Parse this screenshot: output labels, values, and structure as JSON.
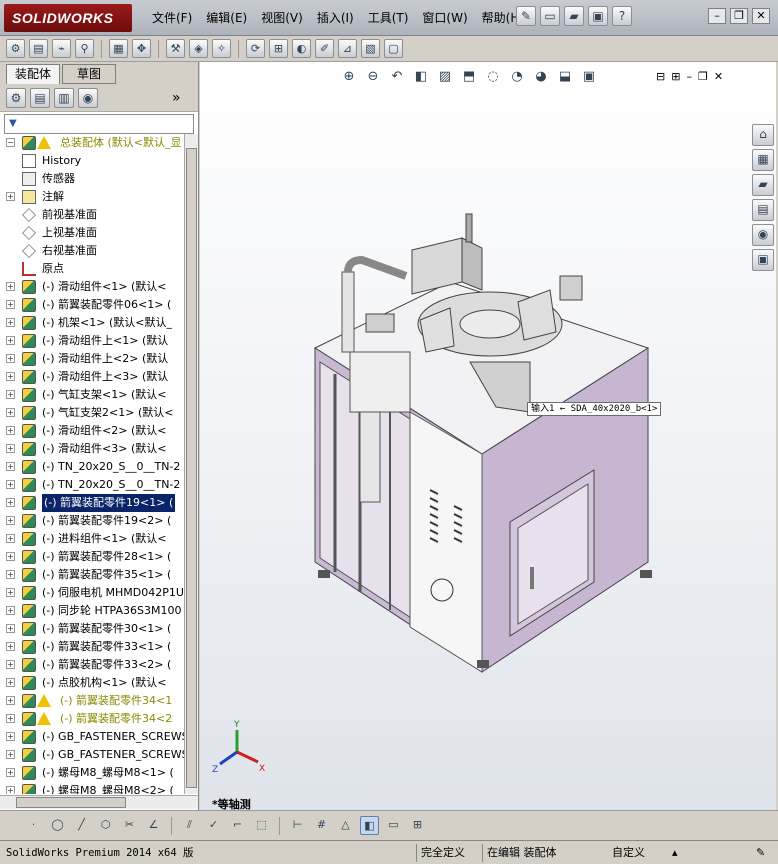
{
  "app": {
    "logo": "SOLIDWORKS"
  },
  "menu": [
    "文件(F)",
    "编辑(E)",
    "视图(V)",
    "插入(I)",
    "工具(T)",
    "窗口(W)",
    "帮助(H)"
  ],
  "panel": {
    "tabs": [
      "装配体",
      "草图"
    ],
    "filter_icon": "filter-icon"
  },
  "tree": [
    {
      "label": "总装配体 (默认<默认_显",
      "type": "root"
    },
    {
      "label": "History",
      "type": "history"
    },
    {
      "label": "传感器",
      "type": "sensor"
    },
    {
      "label": "注解",
      "type": "annotation",
      "exp": true
    },
    {
      "label": "前视基准面",
      "type": "plane"
    },
    {
      "label": "上视基准面",
      "type": "plane"
    },
    {
      "label": "右视基准面",
      "type": "plane"
    },
    {
      "label": "原点",
      "type": "origin"
    },
    {
      "label": "(-) 滑动组件<1> (默认<",
      "type": "part"
    },
    {
      "label": "(-) 箭翼装配零件06<1> (",
      "type": "part"
    },
    {
      "label": "(-) 机架<1> (默认<默认_",
      "type": "part"
    },
    {
      "label": "(-) 滑动组件上<1> (默认",
      "type": "part"
    },
    {
      "label": "(-) 滑动组件上<2> (默认",
      "type": "part"
    },
    {
      "label": "(-) 滑动组件上<3> (默认",
      "type": "part"
    },
    {
      "label": "(-) 气缸支架<1> (默认<",
      "type": "part"
    },
    {
      "label": "(-) 气缸支架2<1> (默认<",
      "type": "part"
    },
    {
      "label": "(-) 滑动组件<2> (默认<",
      "type": "part"
    },
    {
      "label": "(-) 滑动组件<3> (默认<",
      "type": "part"
    },
    {
      "label": "(-) TN_20x20_S__0__TN-2",
      "type": "part"
    },
    {
      "label": "(-) TN_20x20_S__0__TN-2",
      "type": "part"
    },
    {
      "label": "(-) 箭翼装配零件19<1> (",
      "type": "part",
      "selected": true
    },
    {
      "label": "(-) 箭翼装配零件19<2> (",
      "type": "part"
    },
    {
      "label": "(-) 进料组件<1> (默认<",
      "type": "part"
    },
    {
      "label": "(-) 箭翼装配零件28<1> (",
      "type": "part"
    },
    {
      "label": "(-) 箭翼装配零件35<1> (",
      "type": "part"
    },
    {
      "label": "(-) 伺服电机 MHMD042P1U",
      "type": "part"
    },
    {
      "label": "(-) 同步轮 HTPA36S3M100",
      "type": "part"
    },
    {
      "label": "(-) 箭翼装配零件30<1> (",
      "type": "part"
    },
    {
      "label": "(-) 箭翼装配零件33<1> (",
      "type": "part"
    },
    {
      "label": "(-) 箭翼装配零件33<2> (",
      "type": "part"
    },
    {
      "label": "(-) 点胶机构<1> (默认<",
      "type": "part"
    },
    {
      "label": "(-) 箭翼装配零件34<1",
      "type": "warn"
    },
    {
      "label": "(-) 箭翼装配零件34<2",
      "type": "warn"
    },
    {
      "label": "(-) GB_FASTENER_SCREWS_",
      "type": "part"
    },
    {
      "label": "(-) GB_FASTENER_SCREWS_",
      "type": "part"
    },
    {
      "label": "(-) 螺母M8_螺母M8<1> (",
      "type": "part"
    },
    {
      "label": "(-) 螺母M8_螺母M8<2> (",
      "type": "part"
    }
  ],
  "viewport": {
    "callout": "输入1 ← SDA_40x2020_b<1>",
    "view_name": "*等轴测",
    "triad": {
      "x": "X",
      "y": "Y",
      "z": "Z"
    }
  },
  "status": {
    "product": "SolidWorks Premium 2014 x64 版",
    "definition": "完全定义",
    "editing": "在编辑 装配体",
    "units": "自定义"
  }
}
